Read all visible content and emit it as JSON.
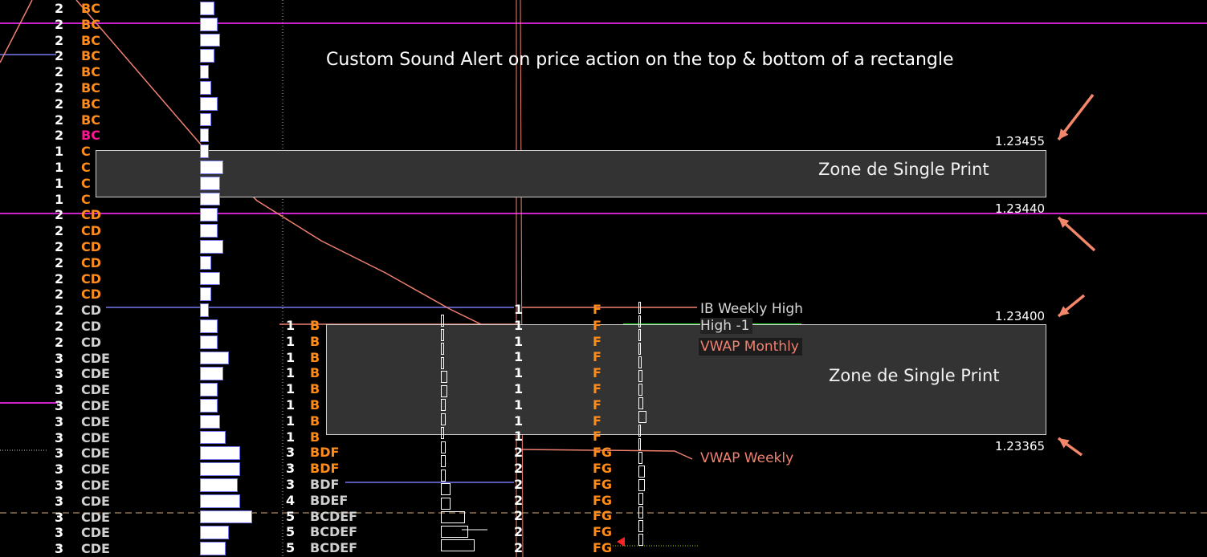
{
  "title": "Custom Sound Alert on price action on the top & bottom of a rectangle",
  "colors": {
    "background": "#000000",
    "magenta_line": "#cc22cc",
    "salmon_line": "#f08070",
    "orange_letters": "#ff8c1a",
    "grey_letters": "#d0d0d0",
    "zone_fill": "#333333",
    "arrow": "#f4876a",
    "green_line": "#22cc22",
    "blue_line": "#7777ee"
  },
  "zones": [
    {
      "label": "Zone de Single Print",
      "top_price": "1.23455",
      "bottom_price": "1.23440"
    },
    {
      "label": "Zone de Single Print",
      "top_price": "1.23400",
      "bottom_price": "1.23365"
    }
  ],
  "level_tags": {
    "ib_weekly_high": "IB Weekly High",
    "high_1": "High -1",
    "vwap_monthly": "VWAP Monthly",
    "vwap_weekly": "VWAP Weekly"
  },
  "profile_left": {
    "counts": [
      "2",
      "2",
      "2",
      "2",
      "2",
      "2",
      "2",
      "2",
      "2",
      "1",
      "1",
      "1",
      "1",
      "2",
      "2",
      "2",
      "2",
      "2",
      "2",
      "2",
      "2",
      "2",
      "3",
      "3",
      "3",
      "3",
      "3",
      "3",
      "3",
      "3",
      "3",
      "3",
      "3",
      "3",
      "3"
    ],
    "letters": [
      "BC",
      "BC",
      "BC",
      "BC",
      "BC",
      "BC",
      "BC",
      "BC",
      "BC",
      "C",
      "C",
      "C",
      "C",
      "CD",
      "CD",
      "CD",
      "CD",
      "CD",
      "CD",
      "CD",
      "CD",
      "CD",
      "CDE",
      "CDE",
      "CDE",
      "CDE",
      "CDE",
      "CDE",
      "CDE",
      "CDE",
      "CDE",
      "CDE",
      "CDE",
      "CDE",
      "CDE"
    ],
    "letter_colors": [
      "orange",
      "orange",
      "orange",
      "orange",
      "orange",
      "orange",
      "orange",
      "orange",
      "magenta",
      "orange",
      "orange",
      "orange",
      "orange",
      "orange",
      "orange",
      "orange",
      "orange",
      "orange",
      "orange",
      "grey",
      "grey",
      "grey",
      "grey",
      "grey",
      "grey",
      "grey",
      "grey",
      "grey",
      "grey",
      "grey",
      "grey",
      "grey",
      "grey",
      "grey",
      "grey"
    ],
    "bar_levels": [
      0.5,
      0.6,
      0.7,
      0.5,
      0.3,
      0.4,
      0.6,
      0.4,
      0.3,
      0.3,
      0.8,
      0.7,
      0.7,
      0.6,
      0.6,
      0.8,
      0.4,
      0.7,
      0.4,
      0.3,
      0.6,
      0.6,
      1.0,
      0.8,
      0.6,
      0.6,
      0.7,
      0.9,
      1.4,
      1.4,
      1.3,
      1.4,
      1.8,
      1.0,
      0.9
    ]
  },
  "profile_mid": {
    "counts": [
      "1",
      "1",
      "1",
      "1",
      "1",
      "1",
      "1",
      "1",
      "3",
      "3",
      "3",
      "4",
      "5",
      "5",
      "5"
    ],
    "letters": [
      "B",
      "B",
      "B",
      "B",
      "B",
      "B",
      "B",
      "B",
      "BDF",
      "BDF",
      "BDF",
      "BDEF",
      "BCDEF",
      "BCDEF",
      "BCDEF"
    ],
    "letter_colors": [
      "orange",
      "orange",
      "orange",
      "orange",
      "orange",
      "orange",
      "orange",
      "orange",
      "orange",
      "orange",
      "grey",
      "grey",
      "grey",
      "grey",
      "grey"
    ]
  },
  "profile_right": {
    "counts": [
      "1",
      "1",
      "1",
      "1",
      "1",
      "1",
      "1",
      "1",
      "1",
      "2",
      "2",
      "2",
      "2",
      "2",
      "2",
      "2"
    ],
    "letters": [
      "F",
      "F",
      "F",
      "F",
      "F",
      "F",
      "F",
      "F",
      "F",
      "FG",
      "FG",
      "FG",
      "FG",
      "FG",
      "FG",
      "FG"
    ]
  }
}
